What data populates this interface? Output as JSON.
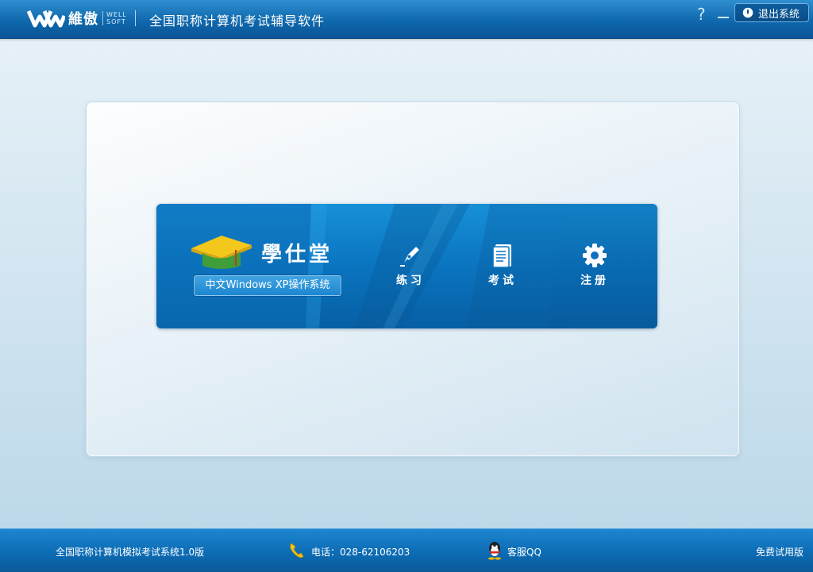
{
  "header": {
    "logo_cn": "維傲",
    "logo_en_line1": "WELL",
    "logo_en_line2": "SOFT",
    "app_title": "全国职称计算机考试辅导软件",
    "help_label": "?",
    "exit_label": "退出系统"
  },
  "banner": {
    "brand_name": "學仕堂",
    "subject_label": "中文Windows XP操作系统",
    "nav": [
      {
        "label": "练习",
        "icon": "pen-icon"
      },
      {
        "label": "考试",
        "icon": "document-icon"
      },
      {
        "label": "注册",
        "icon": "gear-icon"
      }
    ]
  },
  "footer": {
    "version": "全国职称计算机模拟考试系统1.0版",
    "phone": "电话：028-62106203",
    "qq": "客服QQ",
    "trial": "免费试用版"
  },
  "colors": {
    "header_blue": "#0f68ad",
    "banner_blue": "#0a74c0",
    "cap_yellow": "#f3c71c",
    "cap_green": "#3f9e3a"
  }
}
